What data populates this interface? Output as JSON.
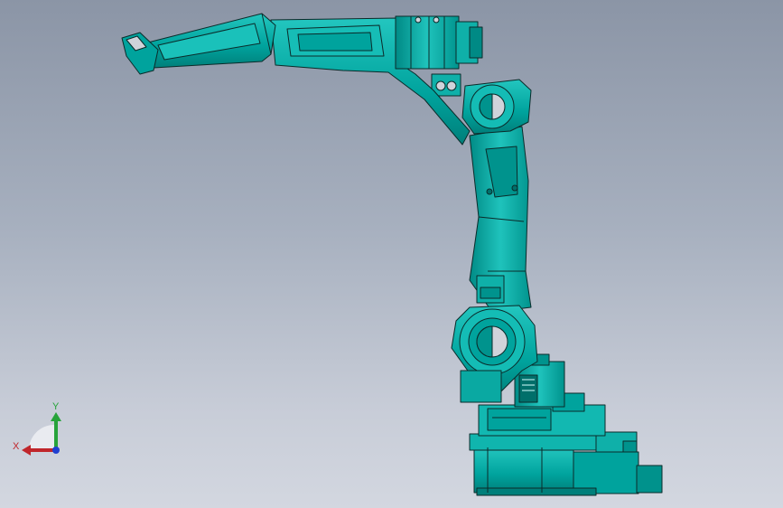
{
  "viewport": {
    "colors": {
      "background_top": "#8b95a6",
      "background_bottom": "#d3d7e0",
      "model_fill": "#00a9a3",
      "model_fill_light": "#19c2bb",
      "model_fill_dark": "#007d78",
      "model_edge": "#0b2b2a"
    }
  },
  "triad": {
    "x_label": "X",
    "y_label": "Y",
    "colors": {
      "x_axis": "#c0262b",
      "y_axis": "#27a33a",
      "z_axis": "#2040d0"
    }
  }
}
